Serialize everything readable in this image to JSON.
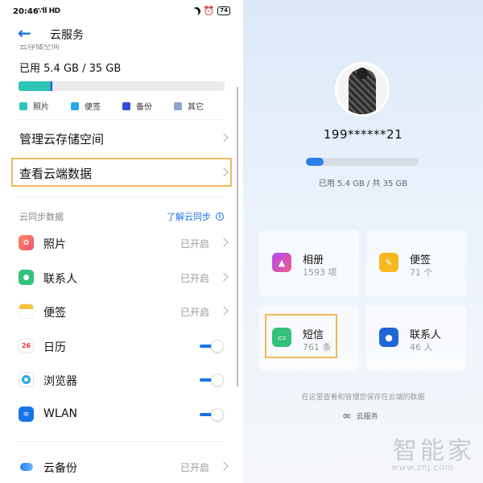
{
  "status_bar": {
    "time": "20:46",
    "signal": "∵ll HD",
    "battery": "74"
  },
  "left": {
    "title": "云服务",
    "storage_label": "云存储空间",
    "used_text": "已用 5.4 GB / 35 GB",
    "usage_segments": [
      {
        "name": "照片",
        "fraction": 0.155,
        "color": "#2ec4b6"
      },
      {
        "name": "备份",
        "fraction": 0.01,
        "color": "#2d4fd6"
      }
    ],
    "legend": [
      {
        "label": "照片",
        "color": "#2ec4b6"
      },
      {
        "label": "便签",
        "color": "#2aa7ea"
      },
      {
        "label": "备份",
        "color": "#2d4fd6"
      },
      {
        "label": "其它",
        "color": "#8ea2cc"
      }
    ],
    "menu": {
      "manage": "管理云存储空间",
      "view": "查看云端数据"
    },
    "sync_header": "云同步数据",
    "learn_link": "了解云同步",
    "sync_items": [
      {
        "name": "照片",
        "state": "已开启",
        "icon": "photos-icon",
        "color": "#f0506e"
      },
      {
        "name": "联系人",
        "state": "已开启",
        "icon": "contacts-icon",
        "color": "#34c27a"
      },
      {
        "name": "便签",
        "state": "已开启",
        "icon": "notes-icon",
        "color": "#f5c23a"
      },
      {
        "name": "日历",
        "state": "",
        "icon": "calendar-icon",
        "color": "#ffffff",
        "toggle": true,
        "calendar_day": "26"
      },
      {
        "name": "浏览器",
        "state": "",
        "icon": "browser-icon",
        "color": "#2aa7ea",
        "toggle": true
      },
      {
        "name": "WLAN",
        "state": "",
        "icon": "wifi-icon",
        "color": "#1a73e8",
        "toggle": true
      }
    ],
    "backup": {
      "name": "云备份",
      "state": "已开启"
    }
  },
  "right": {
    "phone": "199******21",
    "usage_fraction": 0.154,
    "used_text": "已用 5.4 GB / 共 35 GB",
    "cards": [
      {
        "title": "相册",
        "count": "1593 项",
        "icon": "album-icon"
      },
      {
        "title": "便签",
        "count": "71 个",
        "icon": "notes-icon"
      },
      {
        "title": "短信",
        "count": "761 条",
        "icon": "sms-icon"
      },
      {
        "title": "联系人",
        "count": "46 人",
        "icon": "contacts-icon"
      }
    ],
    "footnote": "在这里查看和管理您保存在云端的数据",
    "brand": "云服务"
  },
  "watermark": {
    "cn": "智能家",
    "url": "www.znj.com"
  }
}
